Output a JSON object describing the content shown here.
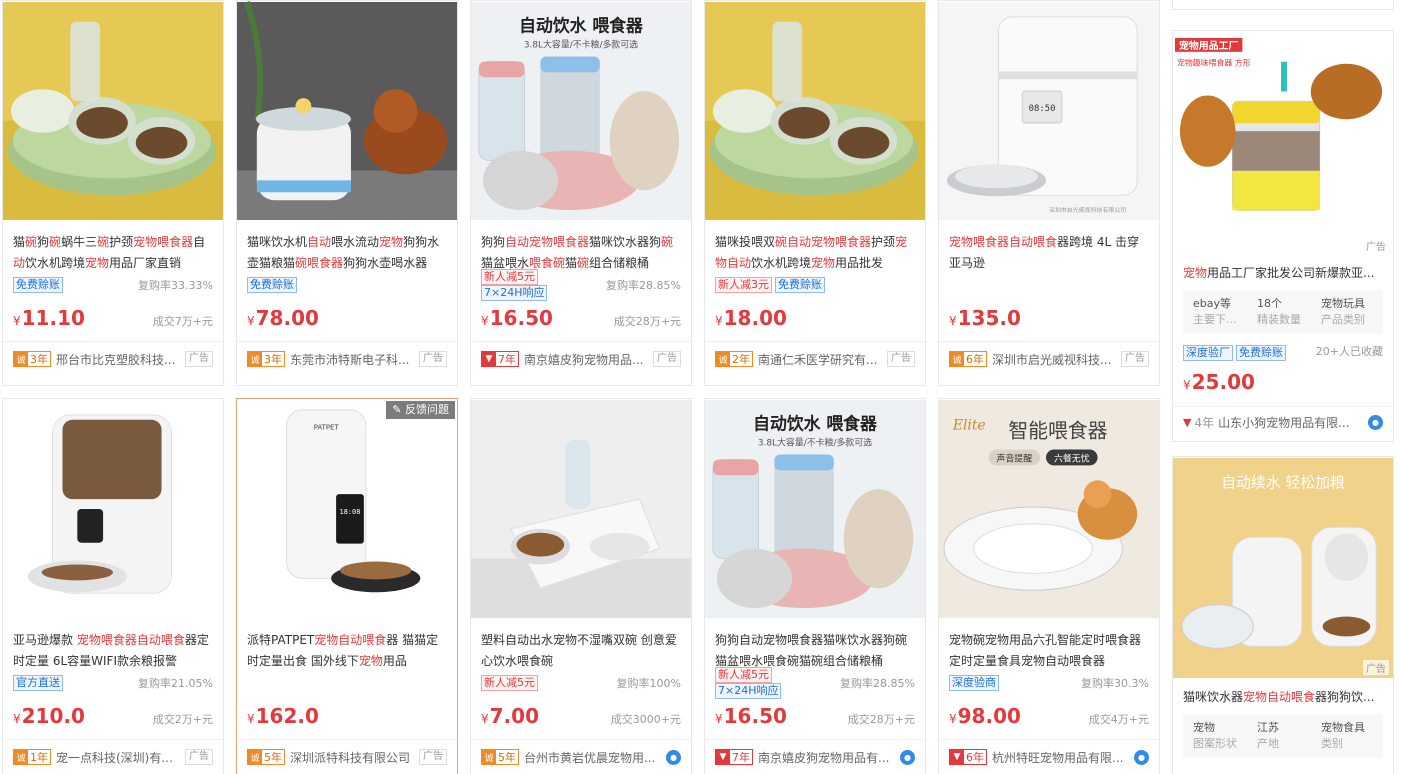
{
  "row1": [
    {
      "title_parts": [
        [
          "猫",
          ""
        ],
        [
          "碗",
          "hl"
        ],
        [
          "狗",
          ""
        ],
        [
          "碗",
          "hl"
        ],
        [
          "蜗牛三",
          ""
        ],
        [
          "碗",
          "hl"
        ],
        [
          "护颈",
          ""
        ],
        [
          "宠物喂食器",
          "hl"
        ],
        [
          "自",
          ""
        ],
        [
          "动",
          "hl"
        ],
        [
          "饮水机跨境",
          ""
        ],
        [
          "宠物",
          "hl"
        ],
        [
          "用品厂家直销",
          ""
        ]
      ],
      "tags": [
        [
          "免费赊账",
          "blue"
        ]
      ],
      "rate": "复购率33.33%",
      "price": "11.10",
      "sold": "成交7万+元",
      "years": "3年",
      "badge": "orange",
      "shop": "邢台市比克塑胶科技...",
      "ad": "广告"
    },
    {
      "title_parts": [
        [
          "猫咪饮水机",
          ""
        ],
        [
          "自动",
          "hl"
        ],
        [
          "喂水流动",
          ""
        ],
        [
          "宠物",
          "hl"
        ],
        [
          "狗狗水壶猫粮猫",
          ""
        ],
        [
          "碗",
          "hl"
        ],
        [
          "喂食",
          "hl"
        ],
        [
          "器",
          "hl"
        ],
        [
          "狗狗水壶喝水器",
          ""
        ]
      ],
      "tags": [
        [
          "免费赊账",
          "blue"
        ]
      ],
      "rate": "",
      "price": "78.00",
      "sold": "",
      "years": "3年",
      "badge": "orange",
      "shop": "东莞市沛特斯电子科...",
      "ad": "广告"
    },
    {
      "title_parts": [
        [
          "狗狗",
          ""
        ],
        [
          "自动宠物喂食器",
          "hl"
        ],
        [
          "猫咪饮水器狗",
          ""
        ],
        [
          "碗",
          "hl"
        ],
        [
          "猫盆喂水",
          ""
        ],
        [
          "喂食碗",
          "hl"
        ],
        [
          "猫",
          ""
        ],
        [
          "碗",
          "hl"
        ],
        [
          "组合储粮桶",
          ""
        ]
      ],
      "tags": [
        [
          "新人减5元",
          "red"
        ],
        [
          "7×24H响应",
          "blue"
        ]
      ],
      "rate": "复购率28.85%",
      "price": "16.50",
      "sold": "成交28万+元",
      "years": "7年",
      "badge": "red",
      "shop": "南京嬉皮狗宠物用品...",
      "ad": "广告"
    },
    {
      "title_parts": [
        [
          "猫咪投喂双",
          ""
        ],
        [
          "碗",
          "hl"
        ],
        [
          "自动宠物喂食器",
          "hl"
        ],
        [
          "护颈",
          ""
        ],
        [
          "宠",
          "hl"
        ],
        [
          "物自动",
          "hl"
        ],
        [
          "饮水机跨境",
          ""
        ],
        [
          "宠物",
          "hl"
        ],
        [
          "用品批发",
          ""
        ]
      ],
      "tags": [
        [
          "新人减3元",
          "red"
        ],
        [
          "免费赊账",
          "blue"
        ]
      ],
      "rate": "",
      "price": "18.00",
      "sold": "",
      "years": "2年",
      "badge": "orange",
      "shop": "南通仁禾医学研究有...",
      "ad": "广告"
    },
    {
      "title_parts": [
        [
          "宠物喂食器",
          "hl"
        ],
        [
          "自动喂食",
          "hl"
        ],
        [
          "器跨境 4L 击穿亚马逊",
          ""
        ]
      ],
      "tags": [],
      "rate": "",
      "price": "135.0",
      "sold": "",
      "years": "6年",
      "badge": "orange",
      "shop": "深圳市启光威视科技...",
      "ad": "广告"
    }
  ],
  "row2": [
    {
      "title_parts": [
        [
          "亚马逊爆款 ",
          ""
        ],
        [
          "宠物喂食器自动喂食",
          "hl"
        ],
        [
          "器定时定量 6L容量WIFI款余粮报警",
          ""
        ]
      ],
      "tags": [
        [
          "官方直送",
          "blue"
        ]
      ],
      "rate": "复购率21.05%",
      "price": "210.0",
      "sold": "成交2万+元",
      "years": "1年",
      "badge": "orange",
      "shop": "宠一点科技(深圳)有...",
      "ad": "广告"
    },
    {
      "title_parts": [
        [
          "派特PATPET",
          ""
        ],
        [
          "宠物自动喂食",
          "hl"
        ],
        [
          "器 猫猫定时定量出食 国外线下",
          ""
        ],
        [
          "宠物",
          "hl"
        ],
        [
          "用品",
          ""
        ]
      ],
      "tags": [],
      "rate": "",
      "price": "162.0",
      "sold": "",
      "years": "5年",
      "badge": "orange",
      "shop": "深圳派特科技有限公司",
      "ad": "广告",
      "feedback": "反馈问题"
    },
    {
      "title_parts": [
        [
          "塑料自动出水宠物不湿嘴双碗 创意爱心饮水喂食碗",
          ""
        ]
      ],
      "tags": [
        [
          "新人减5元",
          "red"
        ]
      ],
      "rate": "复购率100%",
      "price": "7.00",
      "sold": "成交3000+元",
      "years": "5年",
      "badge": "orange",
      "shop": "台州市黄岩优晨宠物用...",
      "ad": ""
    },
    {
      "title_parts": [
        [
          "狗狗自动宠物喂食器猫咪饮水器狗碗猫盆喂水喂食碗猫碗组合储粮桶",
          ""
        ]
      ],
      "tags": [
        [
          "新人减5元",
          "red"
        ],
        [
          "7×24H响应",
          "blue"
        ]
      ],
      "rate": "复购率28.85%",
      "price": "16.50",
      "sold": "成交28万+元",
      "years": "7年",
      "badge": "red",
      "shop": "南京嬉皮狗宠物用品有...",
      "ad": ""
    },
    {
      "title_parts": [
        [
          "宠物碗宠物用品六孔智能定时喂食器定时定量食具宠物自动喂食器",
          ""
        ]
      ],
      "tags": [
        [
          "深度验商",
          "blue"
        ]
      ],
      "rate": "复购率30.3%",
      "price": "98.00",
      "sold": "成交4万+元",
      "years": "6年",
      "badge": "red",
      "shop": "杭州特旺宠物用品有限...",
      "ad": ""
    }
  ],
  "right": [
    {
      "title_parts": [
        [
          "宠物",
          "hl"
        ],
        [
          "用品工厂家批发公司新爆款亚...",
          ""
        ]
      ],
      "attrs": [
        [
          "ebay等",
          "主要下..."
        ],
        [
          "18个",
          "精装数量"
        ],
        [
          "宠物玩具",
          "产品类别"
        ]
      ],
      "tags": [
        [
          "深度验厂",
          "blue"
        ],
        [
          "免费赊账",
          "blue"
        ]
      ],
      "watch": "20+人已收藏",
      "price": "25.00",
      "years": "4年",
      "shop": "山东小狗宠物用品有限..."
    },
    {
      "title_parts": [
        [
          "猫咪饮水器",
          ""
        ],
        [
          "宠物自动喂食",
          "hl"
        ],
        [
          "器狗狗饮...",
          ""
        ]
      ],
      "attrs": [
        [
          "宠物",
          "图案形状"
        ],
        [
          "江苏",
          "产地"
        ],
        [
          "宠物食具",
          "类别"
        ]
      ],
      "ad": "广告"
    }
  ],
  "img_texts": {
    "c3_title": "自动饮水  喂食器",
    "c3_sub": "3.8L大容量/不卡粮/多款可选",
    "c5_screen": "08:50",
    "c5_caption": "深圳市启光威视科技有限公司",
    "r2c4_title": "自动饮水  喂食器",
    "r2c4_sub": "3.8L大容量/不卡粮/多款可选",
    "r2c5_brand": "Elite",
    "r2c5_title": "智能喂食器",
    "r2c5_pill1": "声音提醒",
    "r2c5_pill2": "六餐无忧",
    "right1_brand": "宠物用品工厂",
    "right1_sub": "宠物趣味喂食器 方形",
    "right1_ad": "广告",
    "right2_title": "自动续水 轻松加粮",
    "right2_ad": "广告",
    "r2c2_brand": "PATPET",
    "r2c2_screen": "18:08"
  },
  "colors": {
    "price": "#e4393c",
    "highlight": "#e4393c",
    "tagBlue": "#1a6fd8",
    "badgeOrange": "#f08a24"
  }
}
